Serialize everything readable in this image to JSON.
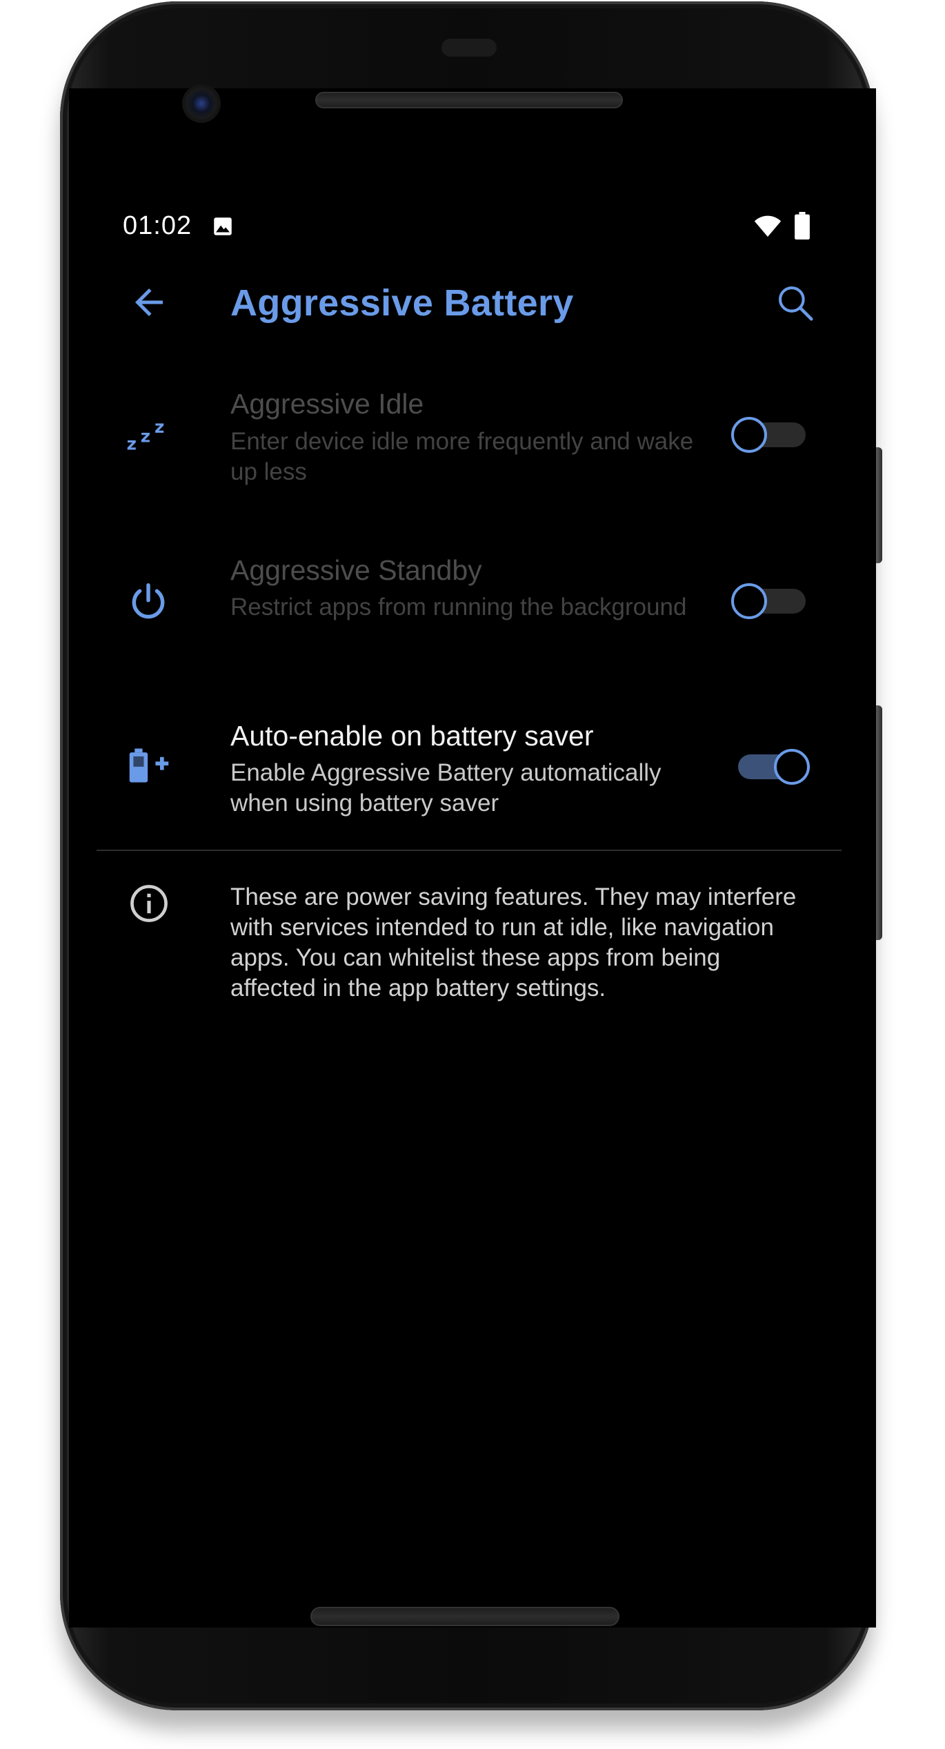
{
  "status_bar": {
    "time": "01:02",
    "icons": [
      "image-icon",
      "wifi-icon",
      "battery-icon"
    ]
  },
  "toolbar": {
    "title": "Aggressive Battery",
    "back_icon": "arrow-back-icon",
    "search_icon": "search-icon"
  },
  "settings": [
    {
      "icon": "sleep-zzz-icon",
      "title": "Aggressive Idle",
      "summary": "Enter device idle more frequently and wake up less",
      "enabled": false,
      "checked": false
    },
    {
      "icon": "power-icon",
      "title": "Aggressive Standby",
      "summary": "Restrict apps from running the background",
      "enabled": false,
      "checked": false
    },
    {
      "icon": "battery-plus-icon",
      "title": "Auto-enable on battery saver",
      "summary": "Enable Aggressive Battery automatically when using battery saver",
      "enabled": true,
      "checked": true
    }
  ],
  "info": {
    "icon": "info-icon",
    "text": "These are power saving features. They may interfere with services intended to run at idle, like navigation apps. You can whitelist these apps from being affected in the app battery settings."
  },
  "colors": {
    "accent": "#6a9be8",
    "background": "#000000",
    "disabled_text": "#4d4d4d",
    "track_off": "#2b2b2b",
    "track_on": "#3c5278"
  }
}
